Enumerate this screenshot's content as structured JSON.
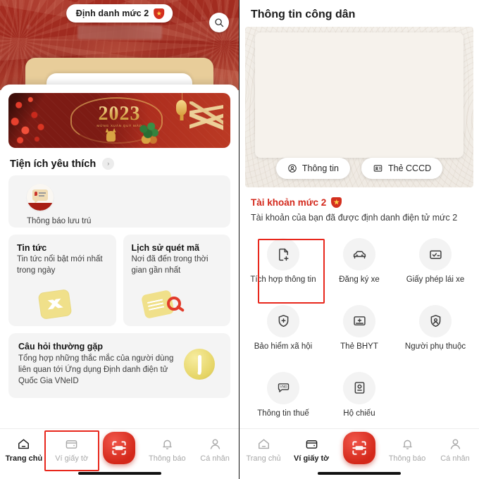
{
  "left": {
    "hero": {
      "badge_label": "Định danh mức 2",
      "badge_icon": "shield-star-icon",
      "search_icon": "search-icon"
    },
    "banner": {
      "year": "2023",
      "subtitle": "MỪNG XUÂN QUÝ MÃO",
      "calligraphy": "An Khang Thịnh Vượng"
    },
    "section": {
      "title": "Tiện ích yêu thích",
      "chevron_icon": "chevron-right-icon"
    },
    "favorite": {
      "label": "Thông báo lưu trú",
      "icon": "residence-notice-icon"
    },
    "cards": [
      {
        "title": "Tin tức",
        "desc": "Tin tức nổi bật mới nhất trong ngày",
        "icon": "news-icon"
      },
      {
        "title": "Lịch sử quét mã",
        "desc": "Nơi đã đến trong thời gian gần nhất",
        "icon": "scan-history-icon"
      }
    ],
    "faq": {
      "title": "Câu hỏi thường gặp",
      "desc": "Tổng hợp những thắc mắc của người dùng liên quan tới Ứng dụng Định danh điện tử Quốc Gia VNeID",
      "icon": "exclamation-coin-icon"
    },
    "nav": {
      "items": [
        {
          "label": "Trang chủ",
          "icon": "home-icon",
          "active": true
        },
        {
          "label": "Ví giấy tờ",
          "icon": "wallet-icon",
          "active": false
        },
        {
          "label": "Thông báo",
          "icon": "bell-icon",
          "active": false
        },
        {
          "label": "Cá nhân",
          "icon": "person-icon",
          "active": false
        }
      ],
      "center_icon": "qr-scan-icon"
    },
    "highlight": {
      "target": "Ví giấy tờ",
      "color": "#e8271c"
    }
  },
  "right": {
    "title": "Thông tin công dân",
    "tabs": [
      {
        "label": "Thông tin",
        "icon": "person-circle-icon"
      },
      {
        "label": "Thẻ CCCD",
        "icon": "id-card-icon"
      }
    ],
    "level": {
      "title": "Tài khoản mức 2",
      "badge_icon": "shield-star-icon",
      "desc": "Tài khoản của bạn đã được định danh điện tử mức 2"
    },
    "grid": [
      {
        "label": "Tích hợp thông tin",
        "icon": "document-plus-icon",
        "highlighted": true
      },
      {
        "label": "Đăng ký xe",
        "icon": "car-icon",
        "highlighted": false
      },
      {
        "label": "Giấy phép lái xe",
        "icon": "license-check-icon",
        "highlighted": false
      },
      {
        "label": "Bảo hiểm xã hội",
        "icon": "shield-plus-icon",
        "highlighted": false
      },
      {
        "label": "Thẻ BHYT",
        "icon": "health-card-icon",
        "highlighted": false
      },
      {
        "label": "Người phụ thuộc",
        "icon": "dependent-person-icon",
        "highlighted": false
      },
      {
        "label": "Thông tin thuế",
        "icon": "vnd-tax-icon",
        "highlighted": false
      },
      {
        "label": "Hộ chiếu",
        "icon": "passport-icon",
        "highlighted": false
      }
    ],
    "nav": {
      "items": [
        {
          "label": "Trang chủ",
          "icon": "home-icon",
          "active": false
        },
        {
          "label": "Ví giấy tờ",
          "icon": "wallet-icon",
          "active": true
        },
        {
          "label": "Thông báo",
          "icon": "bell-icon",
          "active": false
        },
        {
          "label": "Cá nhân",
          "icon": "person-icon",
          "active": false
        }
      ],
      "center_icon": "qr-scan-icon"
    }
  },
  "colors": {
    "brand_red": "#a62d21",
    "accent_red": "#d3291c",
    "highlight": "#e8271c",
    "gold": "#e8cd9a"
  }
}
